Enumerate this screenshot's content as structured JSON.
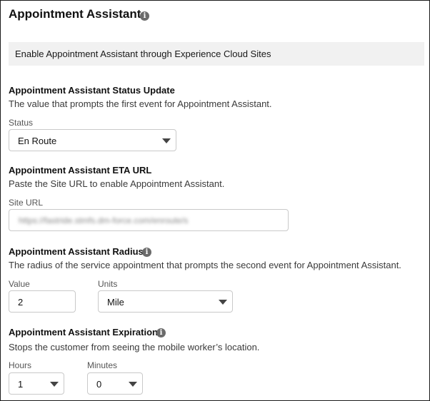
{
  "header": {
    "title": "Appointment Assistant",
    "info_icon": "info-icon"
  },
  "banner": {
    "text": "Enable Appointment Assistant through Experience Cloud Sites"
  },
  "status_update": {
    "heading": "Appointment Assistant Status Update",
    "description": "The value that prompts the first event for Appointment Assistant.",
    "label": "Status",
    "value": "En Route"
  },
  "eta_url": {
    "heading": "Appointment Assistant ETA URL",
    "description": "Paste the Site URL to enable Appointment Assistant.",
    "label": "Site URL",
    "value": "https://fastride.stmfs.dm-force.com/enroute/s"
  },
  "radius": {
    "heading": "Appointment Assistant Radius",
    "description": "The radius of the service appointment that prompts the second event for Appointment Assistant.",
    "value_label": "Value",
    "value": "2",
    "units_label": "Units",
    "units_value": "Mile"
  },
  "expiration": {
    "heading": "Appointment Assistant Expiration",
    "description": "Stops the customer from seeing the mobile worker’s location.",
    "hours_label": "Hours",
    "hours_value": "1",
    "minutes_label": "Minutes",
    "minutes_value": "0"
  }
}
